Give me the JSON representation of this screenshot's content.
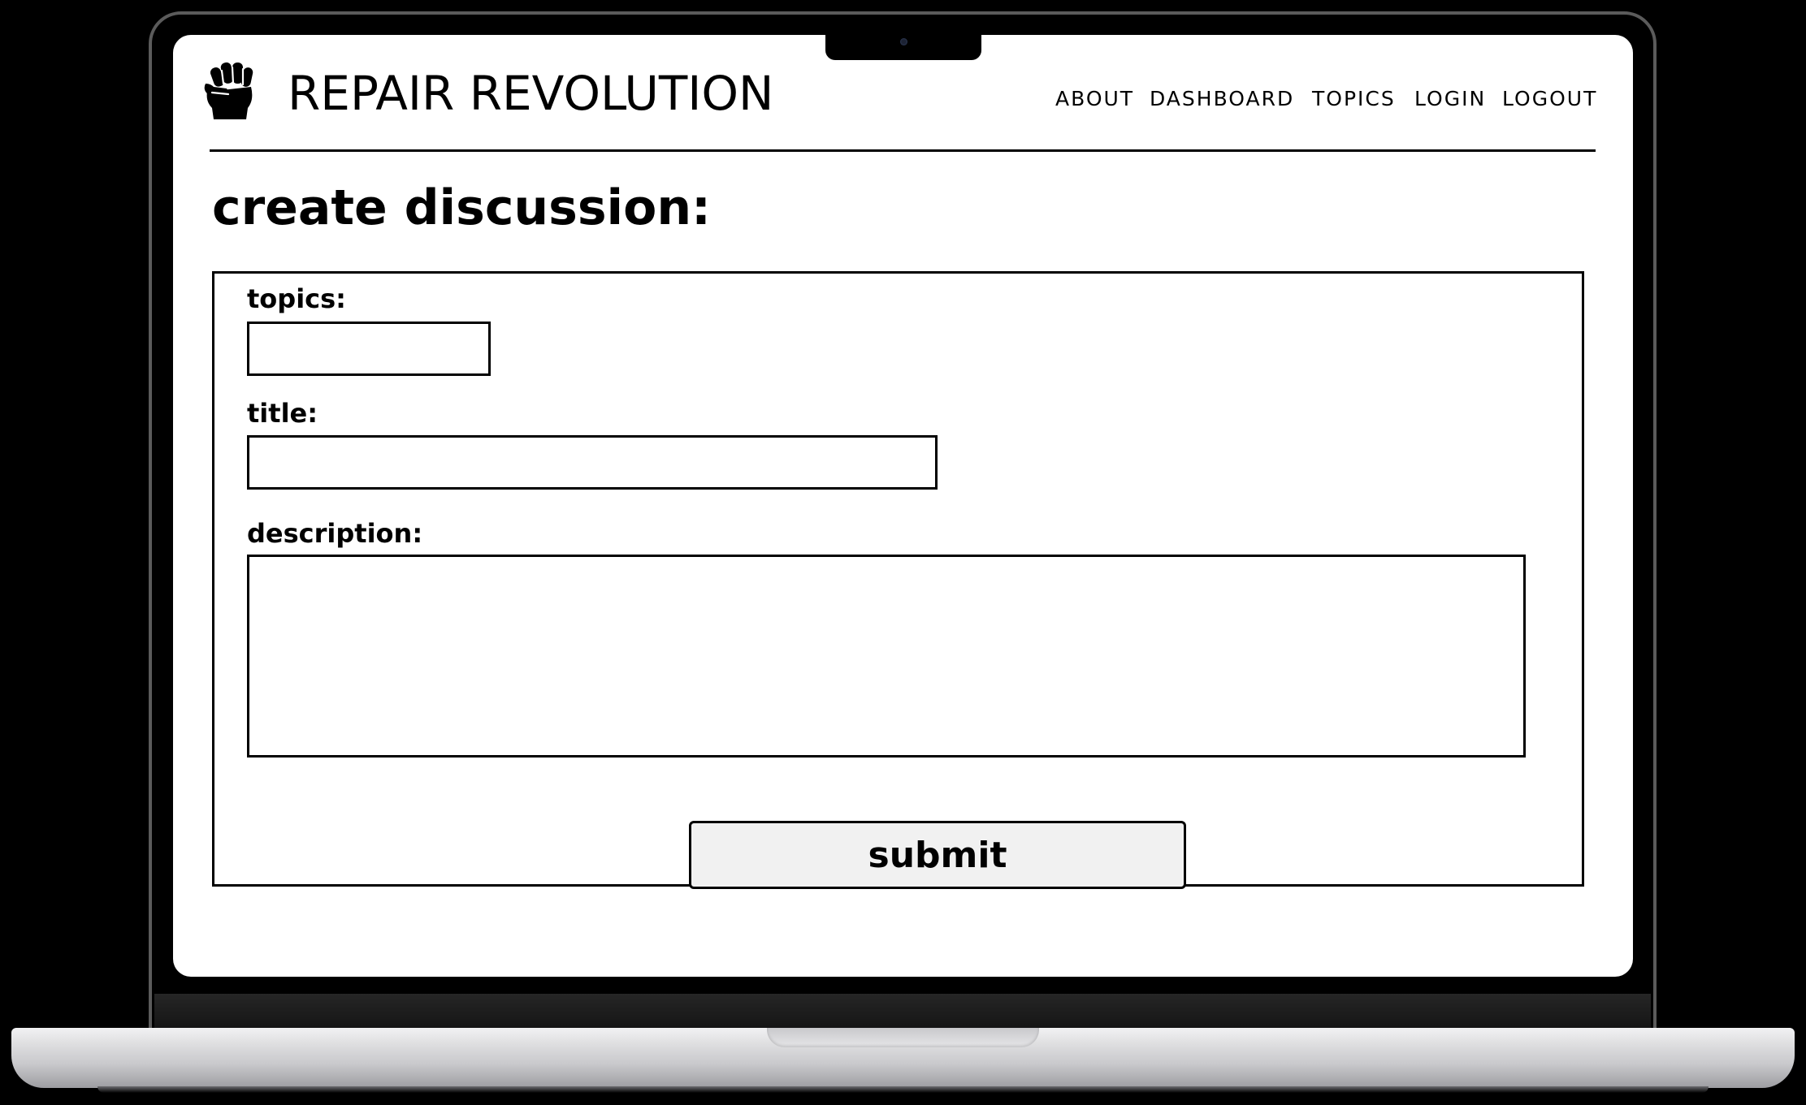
{
  "header": {
    "brand": "REPAIR REVOLUTION",
    "logo_icon": "raised-fist-icon",
    "nav": [
      {
        "label": "ABOUT"
      },
      {
        "label": "DASHBOARD"
      },
      {
        "label": "TOPICS"
      },
      {
        "label": "LOGIN"
      },
      {
        "label": "LOGOUT"
      }
    ]
  },
  "main": {
    "title": "create discussion:",
    "form": {
      "topics": {
        "label": "topics:",
        "value": ""
      },
      "title": {
        "label": "title:",
        "value": ""
      },
      "description": {
        "label": "description:",
        "value": ""
      },
      "submit_label": "submit"
    }
  },
  "colors": {
    "text": "#000000",
    "background": "#ffffff",
    "button_bg": "#f1f1f1"
  }
}
